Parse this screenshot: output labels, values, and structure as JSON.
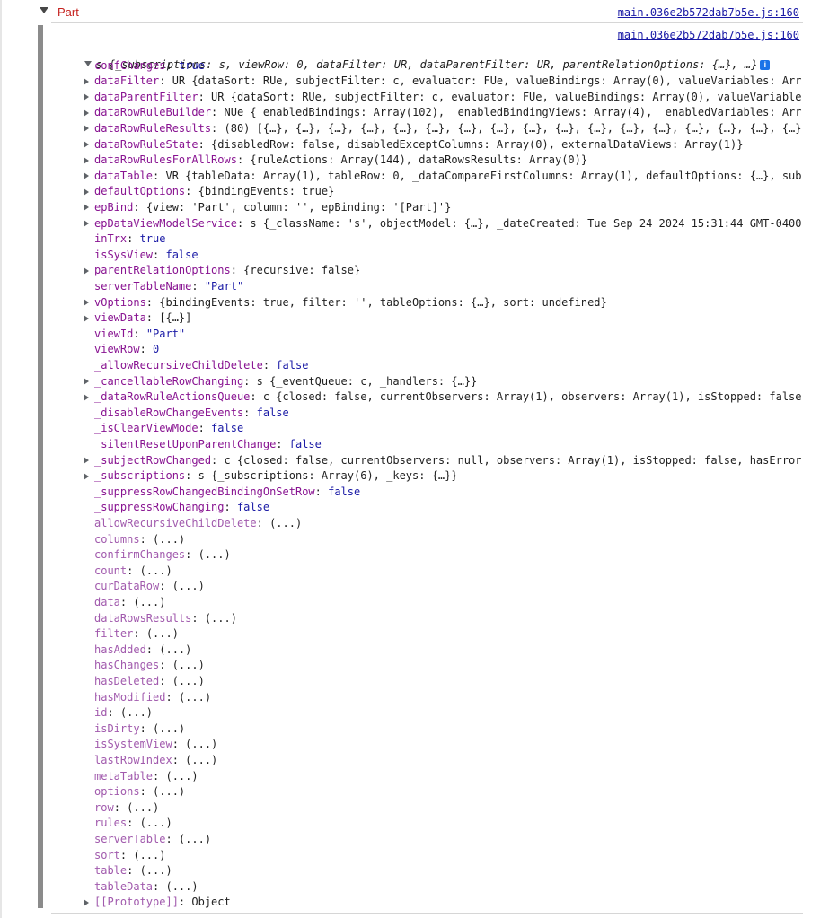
{
  "group": {
    "title": "Part",
    "source_link": "main.036e2b572dab7b5e.js:160"
  },
  "object": {
    "source_link": "main.036e2b572dab7b5e.js:160",
    "summary": "s {_subscriptions: s, viewRow: 0, dataFilter: UR, dataParentFilter: UR, parentRelationOptions: {…}, …}",
    "info_glyph": "i"
  },
  "properties": [
    {
      "key": "confChanges",
      "value": "true",
      "expandable": false,
      "style": "own",
      "vtype": "kw"
    },
    {
      "key": "dataFilter",
      "value": "UR {dataSort: RUe, subjectFilter: c, evaluator: FUe, valueBindings: Array(0), valueVariables: Arr",
      "expandable": true,
      "style": "own",
      "vtype": "plain"
    },
    {
      "key": "dataParentFilter",
      "value": "UR {dataSort: RUe, subjectFilter: c, evaluator: FUe, valueBindings: Array(0), valueVariable",
      "expandable": true,
      "style": "own",
      "vtype": "plain"
    },
    {
      "key": "dataRowRuleBuilder",
      "value": "NUe {_enabledBindings: Array(102), _enabledBindingViews: Array(4), _enabledVariables: Arr",
      "expandable": true,
      "style": "own",
      "vtype": "plain"
    },
    {
      "key": "dataRowRuleResults",
      "value": "(80) [{…}, {…}, {…}, {…}, {…}, {…}, {…}, {…}, {…}, {…}, {…}, {…}, {…}, {…}, {…}, {…}, {…}",
      "expandable": true,
      "style": "own",
      "vtype": "plain"
    },
    {
      "key": "dataRowRuleState",
      "value": "{disabledRow: false, disabledExceptColumns: Array(0), externalDataViews: Array(1)}",
      "expandable": true,
      "style": "own",
      "vtype": "plain"
    },
    {
      "key": "dataRowRulesForAllRows",
      "value": "{ruleActions: Array(144), dataRowsResults: Array(0)}",
      "expandable": true,
      "style": "own",
      "vtype": "plain"
    },
    {
      "key": "dataTable",
      "value": "VR {tableData: Array(1), tableRow: 0, _dataCompareFirstColumns: Array(1), defaultOptions: {…}, sub",
      "expandable": true,
      "style": "own",
      "vtype": "plain"
    },
    {
      "key": "defaultOptions",
      "value": "{bindingEvents: true}",
      "expandable": true,
      "style": "own",
      "vtype": "plain"
    },
    {
      "key": "epBind",
      "value": "{view: 'Part', column: '', epBinding: '[Part]'}",
      "expandable": true,
      "style": "own",
      "vtype": "plain"
    },
    {
      "key": "epDataViewModelService",
      "value": "s {_className: 's', objectModel: {…}, _dateCreated: Tue Sep 24 2024 15:31:44 GMT-0400",
      "expandable": true,
      "style": "own",
      "vtype": "plain"
    },
    {
      "key": "inTrx",
      "value": "true",
      "expandable": false,
      "style": "own",
      "vtype": "kw"
    },
    {
      "key": "isSysView",
      "value": "false",
      "expandable": false,
      "style": "own",
      "vtype": "kw"
    },
    {
      "key": "parentRelationOptions",
      "value": "{recursive: false}",
      "expandable": true,
      "style": "own",
      "vtype": "plain"
    },
    {
      "key": "serverTableName",
      "value": "\"Part\"",
      "expandable": false,
      "style": "own",
      "vtype": "str"
    },
    {
      "key": "vOptions",
      "value": "{bindingEvents: true, filter: '', tableOptions: {…}, sort: undefined}",
      "expandable": true,
      "style": "own",
      "vtype": "plain"
    },
    {
      "key": "viewData",
      "value": "[{…}]",
      "expandable": true,
      "style": "own",
      "vtype": "plain"
    },
    {
      "key": "viewId",
      "value": "\"Part\"",
      "expandable": false,
      "style": "own",
      "vtype": "str"
    },
    {
      "key": "viewRow",
      "value": "0",
      "expandable": false,
      "style": "own",
      "vtype": "kw"
    },
    {
      "key": "_allowRecursiveChildDelete",
      "value": "false",
      "expandable": false,
      "style": "own",
      "vtype": "kw"
    },
    {
      "key": "_cancellableRowChanging",
      "value": "s {_eventQueue: c, _handlers: {…}}",
      "expandable": true,
      "style": "own",
      "vtype": "plain"
    },
    {
      "key": "_dataRowRuleActionsQueue",
      "value": "c {closed: false, currentObservers: Array(1), observers: Array(1), isStopped: false",
      "expandable": true,
      "style": "own",
      "vtype": "plain"
    },
    {
      "key": "_disableRowChangeEvents",
      "value": "false",
      "expandable": false,
      "style": "own",
      "vtype": "kw"
    },
    {
      "key": "_isClearViewMode",
      "value": "false",
      "expandable": false,
      "style": "own",
      "vtype": "kw"
    },
    {
      "key": "_silentResetUponParentChange",
      "value": "false",
      "expandable": false,
      "style": "own",
      "vtype": "kw"
    },
    {
      "key": "_subjectRowChanged",
      "value": "c {closed: false, currentObservers: null, observers: Array(1), isStopped: false, hasError",
      "expandable": true,
      "style": "own",
      "vtype": "plain"
    },
    {
      "key": "_subscriptions",
      "value": "s {_subscriptions: Array(6), _keys: {…}}",
      "expandable": true,
      "style": "own",
      "vtype": "plain"
    },
    {
      "key": "_suppressRowChangedBindingOnSetRow",
      "value": "false",
      "expandable": false,
      "style": "own",
      "vtype": "kw"
    },
    {
      "key": "_suppressRowChanging",
      "value": "false",
      "expandable": false,
      "style": "own",
      "vtype": "kw"
    },
    {
      "key": "allowRecursiveChildDelete",
      "value": "(...)",
      "expandable": false,
      "style": "accessor",
      "vtype": "plain"
    },
    {
      "key": "columns",
      "value": "(...)",
      "expandable": false,
      "style": "accessor",
      "vtype": "plain"
    },
    {
      "key": "confirmChanges",
      "value": "(...)",
      "expandable": false,
      "style": "accessor",
      "vtype": "plain"
    },
    {
      "key": "count",
      "value": "(...)",
      "expandable": false,
      "style": "accessor",
      "vtype": "plain"
    },
    {
      "key": "curDataRow",
      "value": "(...)",
      "expandable": false,
      "style": "accessor",
      "vtype": "plain"
    },
    {
      "key": "data",
      "value": "(...)",
      "expandable": false,
      "style": "accessor",
      "vtype": "plain"
    },
    {
      "key": "dataRowsResults",
      "value": "(...)",
      "expandable": false,
      "style": "accessor",
      "vtype": "plain"
    },
    {
      "key": "filter",
      "value": "(...)",
      "expandable": false,
      "style": "accessor",
      "vtype": "plain"
    },
    {
      "key": "hasAdded",
      "value": "(...)",
      "expandable": false,
      "style": "accessor",
      "vtype": "plain"
    },
    {
      "key": "hasChanges",
      "value": "(...)",
      "expandable": false,
      "style": "accessor",
      "vtype": "plain"
    },
    {
      "key": "hasDeleted",
      "value": "(...)",
      "expandable": false,
      "style": "accessor",
      "vtype": "plain"
    },
    {
      "key": "hasModified",
      "value": "(...)",
      "expandable": false,
      "style": "accessor",
      "vtype": "plain"
    },
    {
      "key": "id",
      "value": "(...)",
      "expandable": false,
      "style": "accessor",
      "vtype": "plain"
    },
    {
      "key": "isDirty",
      "value": "(...)",
      "expandable": false,
      "style": "accessor",
      "vtype": "plain"
    },
    {
      "key": "isSystemView",
      "value": "(...)",
      "expandable": false,
      "style": "accessor",
      "vtype": "plain"
    },
    {
      "key": "lastRowIndex",
      "value": "(...)",
      "expandable": false,
      "style": "accessor",
      "vtype": "plain"
    },
    {
      "key": "metaTable",
      "value": "(...)",
      "expandable": false,
      "style": "accessor",
      "vtype": "plain"
    },
    {
      "key": "options",
      "value": "(...)",
      "expandable": false,
      "style": "accessor",
      "vtype": "plain"
    },
    {
      "key": "row",
      "value": "(...)",
      "expandable": false,
      "style": "accessor",
      "vtype": "plain"
    },
    {
      "key": "rules",
      "value": "(...)",
      "expandable": false,
      "style": "accessor",
      "vtype": "plain"
    },
    {
      "key": "serverTable",
      "value": "(...)",
      "expandable": false,
      "style": "accessor",
      "vtype": "plain"
    },
    {
      "key": "sort",
      "value": "(...)",
      "expandable": false,
      "style": "accessor",
      "vtype": "plain"
    },
    {
      "key": "table",
      "value": "(...)",
      "expandable": false,
      "style": "accessor",
      "vtype": "plain"
    },
    {
      "key": "tableData",
      "value": "(...)",
      "expandable": false,
      "style": "accessor",
      "vtype": "plain"
    },
    {
      "key": "[[Prototype]]",
      "value": "Object",
      "expandable": true,
      "style": "internal",
      "vtype": "plain"
    }
  ]
}
